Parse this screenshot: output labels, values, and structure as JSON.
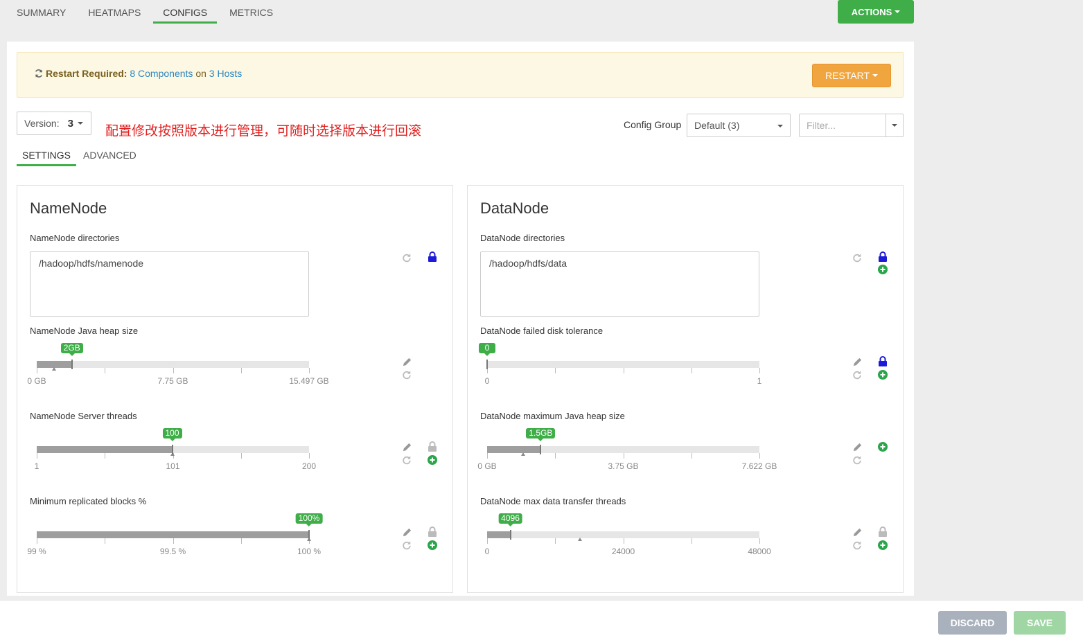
{
  "top_tabs": [
    {
      "label": "SUMMARY"
    },
    {
      "label": "HEATMAPS"
    },
    {
      "label": "CONFIGS"
    },
    {
      "label": "METRICS"
    }
  ],
  "actions_label": "ACTIONS",
  "alert": {
    "title": "Restart Required:",
    "components_link": "8 Components",
    "on_text": "on",
    "hosts_link": "3 Hosts",
    "restart_label": "RESTART"
  },
  "version": {
    "label": "Version:",
    "value": "3"
  },
  "annotation": "配置修改按照版本进行管理，可随时选择版本进行回滚",
  "config_group": {
    "label": "Config Group",
    "value": "Default (3)"
  },
  "filter": {
    "placeholder": "Filter..."
  },
  "sub_tabs": [
    {
      "label": "SETTINGS"
    },
    {
      "label": "ADVANCED"
    }
  ],
  "namenode": {
    "title": "NameNode",
    "directories": {
      "label": "NameNode directories",
      "value": "/hadoop/hdfs/namenode"
    },
    "heap": {
      "label": "NameNode Java heap size",
      "value_label": "2GB",
      "value": 2,
      "min": 0,
      "max": 15.497,
      "default": 1,
      "ticks": [
        "0 GB",
        "7.75 GB",
        "15.497 GB"
      ]
    },
    "threads": {
      "label": "NameNode Server threads",
      "value_label": "100",
      "value": 100,
      "min": 1,
      "max": 200,
      "default": 100,
      "ticks": [
        "1",
        "101",
        "200"
      ]
    },
    "min_blocks": {
      "label": "Minimum replicated blocks %",
      "value_label": "100%",
      "value": 100,
      "min": 99,
      "max": 100,
      "default": 100,
      "ticks": [
        "99 %",
        "99.5 %",
        "100 %"
      ]
    }
  },
  "datanode": {
    "title": "DataNode",
    "directories": {
      "label": "DataNode directories",
      "value": "/hadoop/hdfs/data"
    },
    "failed_disk": {
      "label": "DataNode failed disk tolerance",
      "value_label": "0",
      "value": 0,
      "min": 0,
      "max": 1,
      "ticks": [
        "0",
        "1"
      ]
    },
    "heap": {
      "label": "DataNode maximum Java heap size",
      "value_label": "1.5GB",
      "value": 1.5,
      "min": 0,
      "max": 7.622,
      "default": 1,
      "ticks": [
        "0 GB",
        "3.75 GB",
        "7.622 GB"
      ]
    },
    "transfer_threads": {
      "label": "DataNode max data transfer threads",
      "value_label": "4096",
      "value": 4096,
      "min": 0,
      "max": 48000,
      "default": 16384,
      "ticks": [
        "0",
        "24000",
        "48000"
      ]
    }
  },
  "footer": {
    "discard_label": "DISCARD",
    "save_label": "SAVE"
  },
  "colors": {
    "green": "#3fae49",
    "orange": "#f0a53e",
    "blue_lock": "#1b1bd8",
    "link": "#2e86c1",
    "annotation_red": "#e02020"
  }
}
